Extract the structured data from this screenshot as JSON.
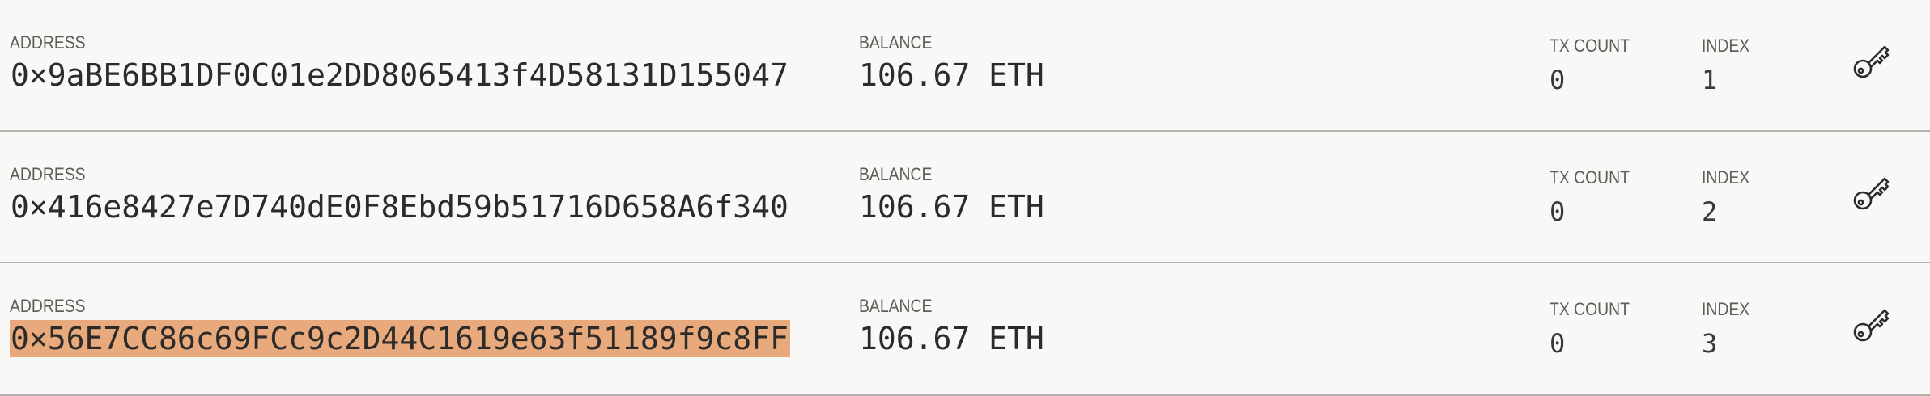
{
  "labels": {
    "address": "ADDRESS",
    "balance": "BALANCE",
    "tx_count": "TX COUNT",
    "index": "INDEX"
  },
  "accounts": [
    {
      "address": "0×9aBE6BB1DF0C01e2DD8065413f4D58131D155047",
      "balance": "106.67 ETH",
      "tx_count": "0",
      "index": "1",
      "selected": false
    },
    {
      "address": "0×416e8427e7D740dE0F8Ebd59b51716D658A6f340",
      "balance": "106.67 ETH",
      "tx_count": "0",
      "index": "2",
      "selected": false
    },
    {
      "address": "0×56E7CC86c69FCc9c2D44C1619e63f51189f9c8FF",
      "balance": "106.67 ETH",
      "tx_count": "0",
      "index": "3",
      "selected": true
    }
  ],
  "icons": {
    "key": "key-icon"
  },
  "colors": {
    "background": "#f9f8f6",
    "selection": "#e8a97c",
    "divider": "#b5b3b0",
    "text": "#2d2b29",
    "label": "#5f5d5a"
  }
}
